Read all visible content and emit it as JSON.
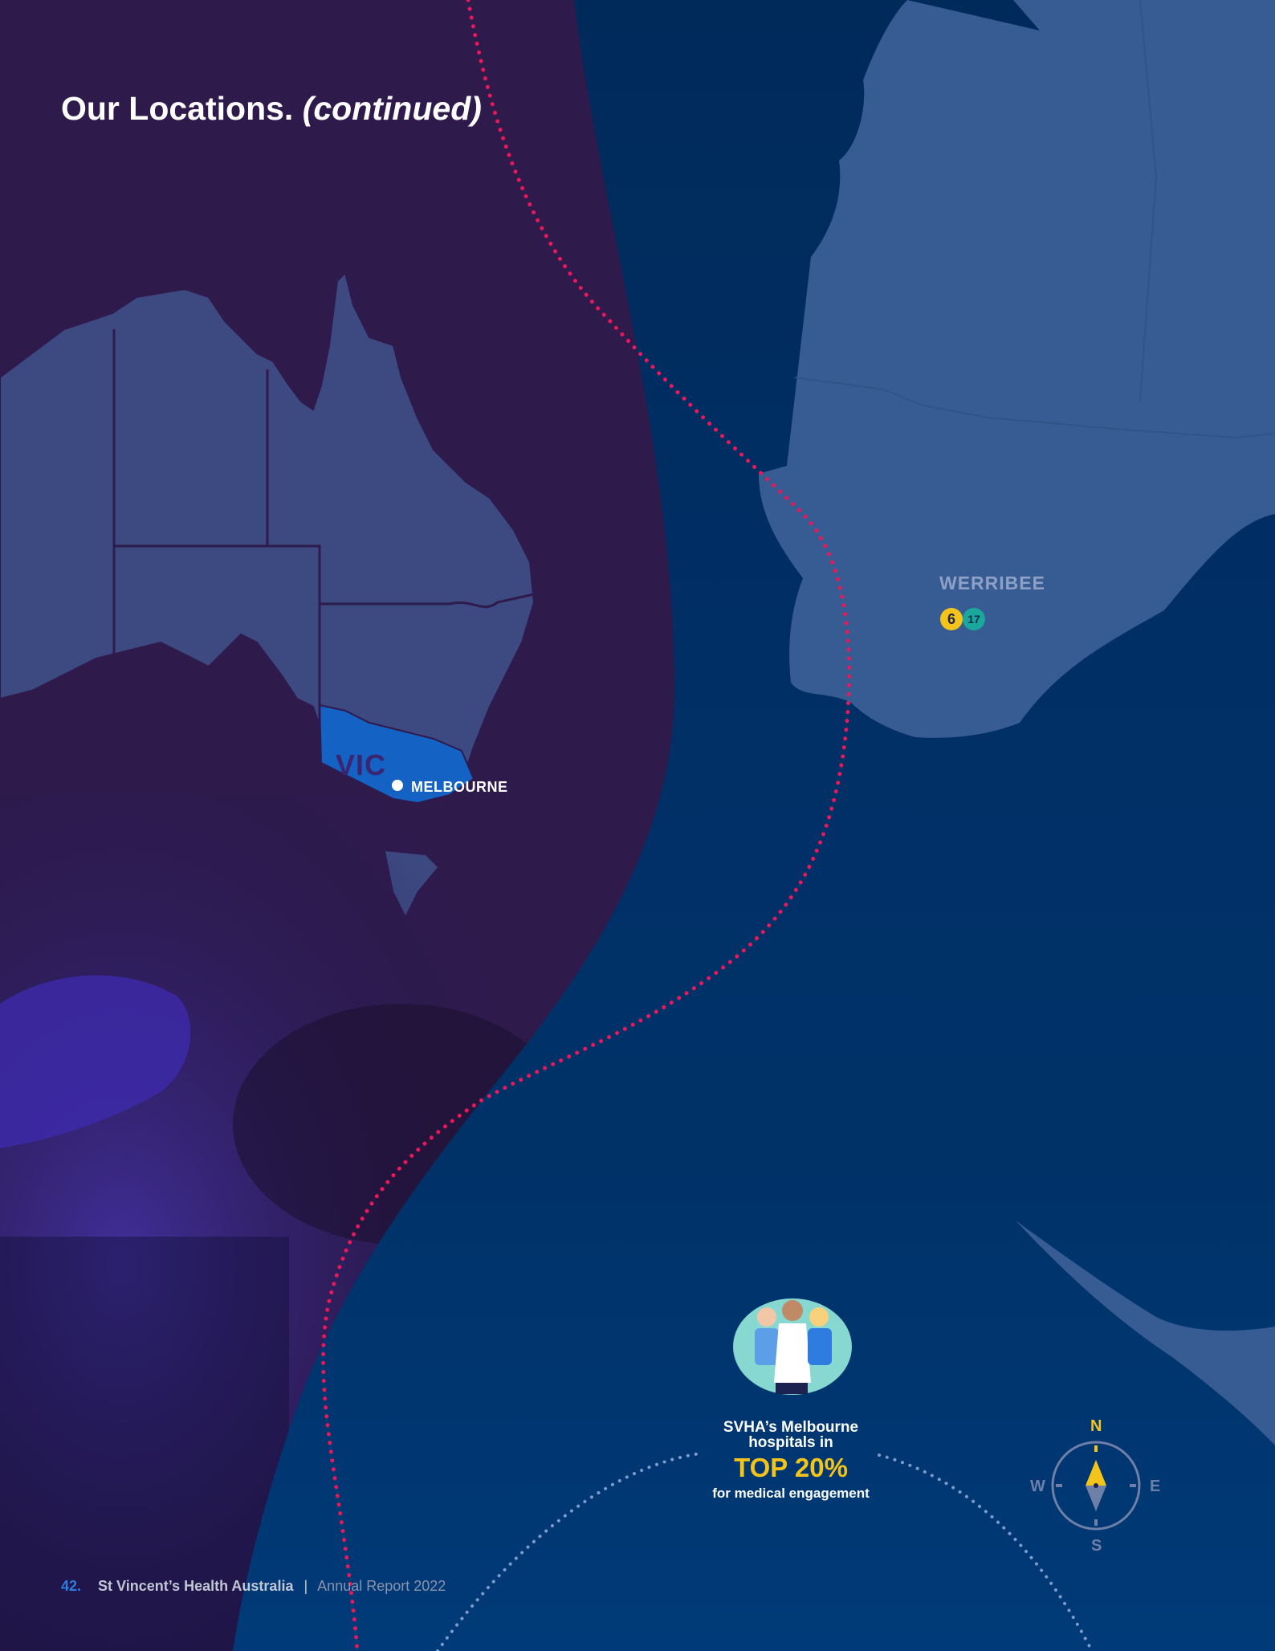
{
  "page": {
    "title_main": "Our Locations.",
    "title_italic": "(continued)"
  },
  "map": {
    "state_label": "VIC",
    "city_label": "MELBOURNE",
    "detail_location": "WERRIBEE",
    "badges": [
      "6",
      "17"
    ],
    "colors": {
      "background": "#002f66",
      "purple_panel": "#2f1a4c",
      "landmass": "#3d4a82",
      "victoria": "#1462c4",
      "detail_land": "#375c93",
      "route_dots": "#e8185a",
      "badge_yellow": "#f5c41b",
      "badge_teal": "#1aa79c"
    }
  },
  "callout": {
    "line1": "SVHA’s Melbourne",
    "line2": "hospitals in",
    "highlight": "TOP 20%",
    "line3": "for medical engagement"
  },
  "compass": {
    "n": "N",
    "s": "S",
    "w": "W",
    "e": "E"
  },
  "footer": {
    "page_number": "42.",
    "organisation": "St Vincent’s Health Australia",
    "separator": "|",
    "report": "Annual Report 2022"
  }
}
